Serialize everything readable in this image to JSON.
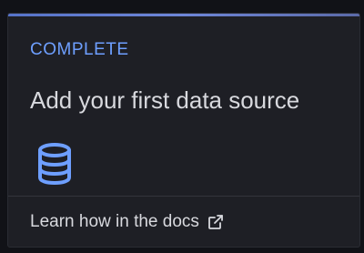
{
  "card": {
    "status": "COMPLETE",
    "title": "Add your first data source",
    "icon": "database-icon",
    "link": {
      "label": "Learn how in the docs",
      "icon": "external-link-icon"
    }
  },
  "colors": {
    "accent": "#6e9fff",
    "top_bar": "#5673c9",
    "card_bg": "#1e1f25",
    "page_bg": "#111217",
    "text": "#d8d9de"
  }
}
